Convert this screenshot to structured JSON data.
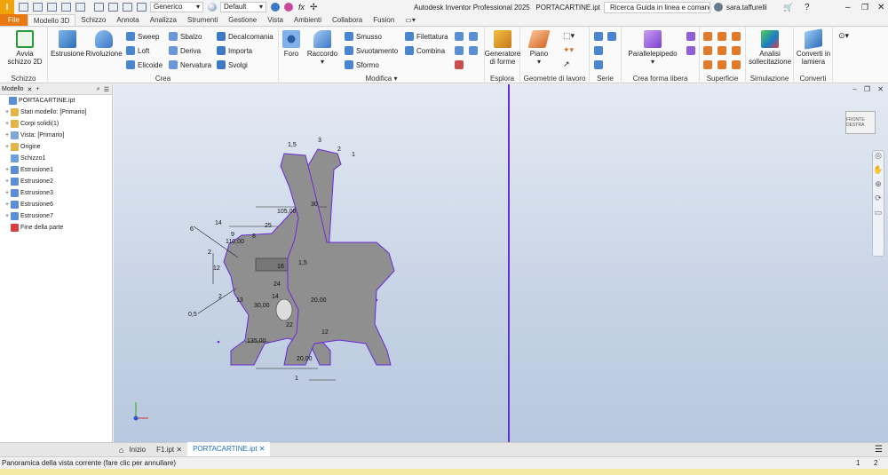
{
  "qat": {
    "logo": "I",
    "style_dropdown": "Generico",
    "appearance_dropdown": "Default"
  },
  "title": {
    "app": "Autodesk Inventor Professional 2025",
    "file": "PORTACARTINE.ipt",
    "help_search": "Ricerca Guida in linea e comand",
    "user": "sara.taffurelli"
  },
  "menu_tabs": [
    "File",
    "Modello 3D",
    "Schizzo",
    "Annota",
    "Analizza",
    "Strumenti",
    "Gestione",
    "Vista",
    "Ambienti",
    "Collabora",
    "Fusion"
  ],
  "active_tab": "Modello 3D",
  "ribbon": {
    "schizzo": {
      "title": "Schizzo",
      "start_sketch": "Avvia schizzo 2D"
    },
    "crea": {
      "title": "Crea",
      "extrude": "Estrusione",
      "revolve": "Rivoluzione",
      "small": [
        "Sweep",
        "Loft",
        "Elicoide",
        "Sbalzo",
        "Deriva",
        "Nervatura",
        "Decalcomania",
        "Importa",
        "Svolgi"
      ]
    },
    "modifica": {
      "title": "Modifica",
      "fillet": "Raccordo",
      "face": "Foro",
      "small": [
        "Smusso",
        "Svuotamento",
        "Sformo",
        "Filettatura",
        "Combina"
      ]
    },
    "esplora": {
      "title": "Esplora",
      "generator": "Generatore di forme"
    },
    "geometrie": {
      "title": "Geometrie di lavoro",
      "plane": "Piano"
    },
    "serie": {
      "title": "Serie"
    },
    "forma_libera": {
      "title": "Crea forma libera",
      "box": "Parallelepipedo"
    },
    "superficie": {
      "title": "Superficie"
    },
    "simulazione": {
      "title": "Simulazione",
      "stress": "Analisi sollecitazione"
    },
    "converti": {
      "title": "Converti",
      "sheet": "Converti in lamiera"
    }
  },
  "browser": {
    "tab": "Modello",
    "items": [
      {
        "label": "PORTACARTINE.ipt",
        "level": 0,
        "exp": "",
        "color": "#5b8ed6"
      },
      {
        "label": "Stati modello: [Primario]",
        "level": 1,
        "exp": "+",
        "color": "#e3b448"
      },
      {
        "label": "Corpi solidi(1)",
        "level": 1,
        "exp": "+",
        "color": "#e3b448"
      },
      {
        "label": "Vista: [Primario]",
        "level": 1,
        "exp": "+",
        "color": "#7fa8d8"
      },
      {
        "label": "Origine",
        "level": 1,
        "exp": "+",
        "color": "#e3b448"
      },
      {
        "label": "Schizzo1",
        "level": 1,
        "exp": "",
        "color": "#6fa0dc"
      },
      {
        "label": "Estrusione1",
        "level": 1,
        "exp": "+",
        "color": "#5b8ed6"
      },
      {
        "label": "Estrusione2",
        "level": 1,
        "exp": "+",
        "color": "#5b8ed6"
      },
      {
        "label": "Estrusione3",
        "level": 1,
        "exp": "+",
        "color": "#5b8ed6"
      },
      {
        "label": "Estrusione6",
        "level": 1,
        "exp": "+",
        "color": "#5b8ed6"
      },
      {
        "label": "Estrusione7",
        "level": 1,
        "exp": "+",
        "color": "#5b8ed6"
      },
      {
        "label": "Fine della parte",
        "level": 1,
        "exp": "",
        "color": "#d64040"
      }
    ]
  },
  "viewport": {
    "viewcube_text": "FRONTE DESTRA"
  },
  "dims": [
    "1,5",
    "3",
    "2",
    "1",
    "105,00",
    "30",
    "25",
    "14",
    "9",
    "8",
    "6",
    "110,00",
    "2",
    "12",
    "16",
    "1,5",
    "0,5",
    "24",
    "2",
    "13",
    "30,00",
    "14",
    "20,00",
    "22",
    "135,00",
    "12",
    "20,00",
    "1"
  ],
  "doc_tabs": [
    "Inizio",
    "F1.ipt",
    "PORTACARTINE.ipt"
  ],
  "active_doc": "PORTACARTINE.ipt",
  "status": {
    "text": "Panoramica della vista corrente (fare clic per annullare)",
    "n1": "1",
    "n2": "2"
  },
  "colors": {
    "accent": "#6a2bd9",
    "file_tab": "#e8780f",
    "viewport_top": "#e4eaf3",
    "viewport_bottom": "#b8c8de"
  }
}
